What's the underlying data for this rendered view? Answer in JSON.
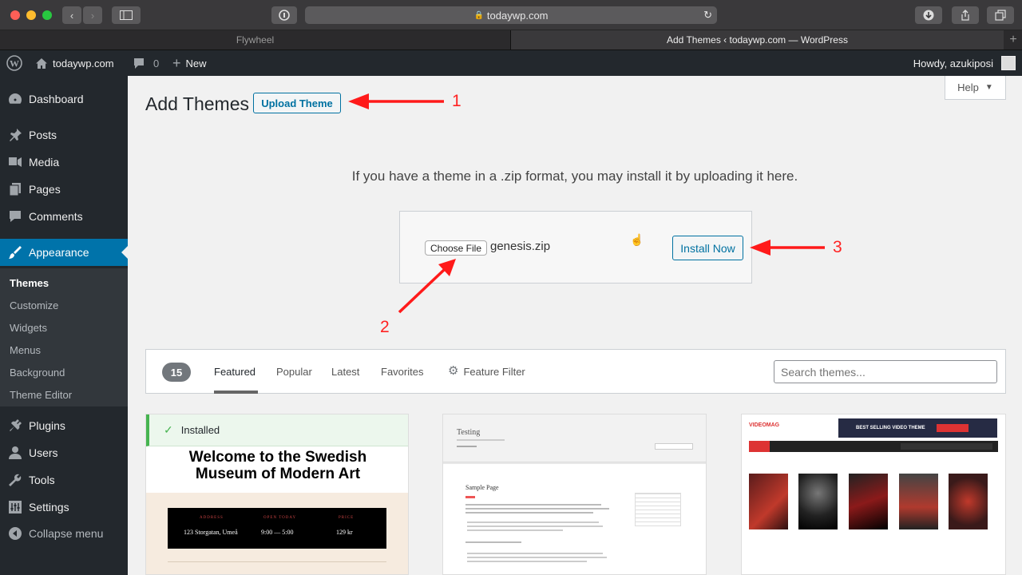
{
  "browser": {
    "url": "todaywp.com",
    "tabs": [
      "Flywheel",
      "Add Themes ‹ todaywp.com — WordPress"
    ]
  },
  "admin_bar": {
    "site_name": "todaywp.com",
    "comments_count": "0",
    "new_label": "New",
    "greeting": "Howdy, azukiposi"
  },
  "sidebar": {
    "items": [
      {
        "label": "Dashboard",
        "icon": "dashboard-icon"
      },
      {
        "label": "Posts",
        "icon": "pin-icon"
      },
      {
        "label": "Media",
        "icon": "media-icon"
      },
      {
        "label": "Pages",
        "icon": "pages-icon"
      },
      {
        "label": "Comments",
        "icon": "comment-icon"
      },
      {
        "label": "Appearance",
        "icon": "brush-icon"
      },
      {
        "label": "Plugins",
        "icon": "plugin-icon"
      },
      {
        "label": "Users",
        "icon": "user-icon"
      },
      {
        "label": "Tools",
        "icon": "wrench-icon"
      },
      {
        "label": "Settings",
        "icon": "settings-icon"
      },
      {
        "label": "Collapse menu",
        "icon": "collapse-icon"
      }
    ],
    "submenu": [
      "Themes",
      "Customize",
      "Widgets",
      "Menus",
      "Background",
      "Theme Editor"
    ]
  },
  "page": {
    "title": "Add Themes",
    "upload_button": "Upload Theme",
    "help_label": "Help",
    "upload_info": "If you have a theme in a .zip format, you may install it by uploading it here.",
    "choose_file": "Choose File",
    "file_name": "genesis.zip",
    "install_button": "Install Now"
  },
  "annotations": [
    "1",
    "2",
    "3"
  ],
  "filter": {
    "count": "15",
    "tabs": [
      "Featured",
      "Popular",
      "Latest",
      "Favorites"
    ],
    "feature_filter": "Feature Filter",
    "search_placeholder": "Search themes..."
  },
  "themes": {
    "installed_label": "Installed",
    "card1": {
      "heading": "Welcome to the Swedish Museum of Modern Art",
      "address_label": "ADDRESS",
      "address": "123 Storgatan, Umeå",
      "hours_label": "OPEN TODAY",
      "hours": "9:00 — 5:00",
      "price_label": "PRICE",
      "price": "129 kr"
    },
    "card2": {
      "site_title": "Testing",
      "page_title": "Sample Page"
    },
    "card3": {
      "logo": "VIDEOMAG",
      "banner": "BEST SELLING VIDEO THEME"
    }
  },
  "colors": {
    "wp_dark": "#23282d",
    "wp_blue": "#0073aa",
    "annotation_red": "#ff1a1a"
  }
}
